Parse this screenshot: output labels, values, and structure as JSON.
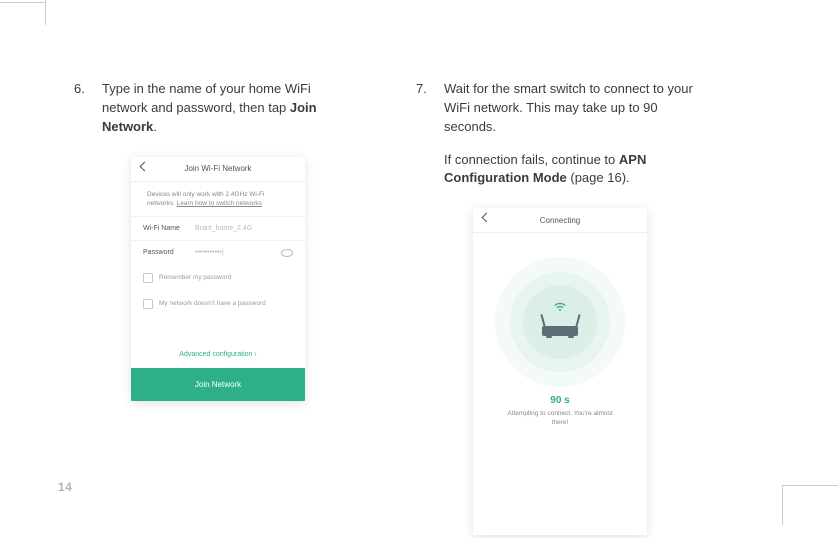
{
  "page_number": "14",
  "step6": {
    "num": "6.",
    "text_a": "Type in the name of your home WiFi network and password, then tap ",
    "bold": "Join Network",
    "text_b": "."
  },
  "step7": {
    "num": "7.",
    "text_a": "Wait for the smart switch to connect to your WiFi network. This may take up to 90 seconds.",
    "para2_a": "If connection fails, continue to ",
    "para2_bold": "APN Configuration Mode",
    "para2_b": " (page 16)."
  },
  "phone1": {
    "title": "Join Wi-Fi Network",
    "info_a": "Devices will only work with 2.4GHz Wi-Fi networks. ",
    "info_link": "Learn how to switch networks",
    "row_name_label": "Wi-Fi Name",
    "row_name_value": "Brant_home_2.4G",
    "row_pw_label": "Password",
    "row_pw_value": "•••••••••••|",
    "remember": "Remember my password",
    "nopw": "My network doesn't have a password",
    "advanced": "Advanced configuration ›",
    "cta": "Join Network"
  },
  "phone2": {
    "title": "Connecting",
    "timer": "90 s",
    "attempting": "Attempting to connect. You're almost there!"
  }
}
